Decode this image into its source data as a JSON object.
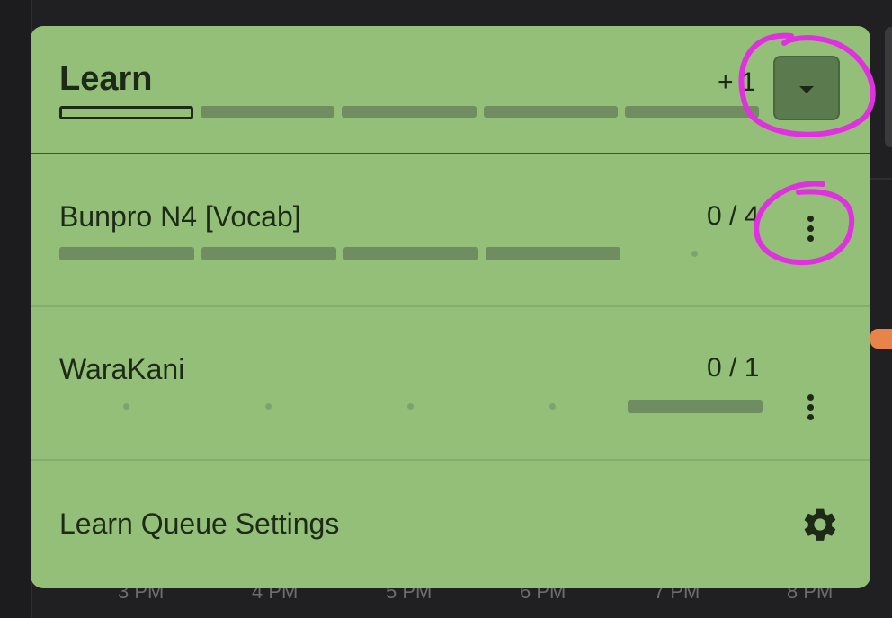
{
  "popover": {
    "title": "Learn",
    "count": "+ 1",
    "dropdown_icon": "caret-down-icon",
    "segments_total": 5,
    "segments_active_index": 0
  },
  "queues": [
    {
      "name": "Bunpro N4 [Vocab]",
      "count": "0 / 4",
      "menu_icon": "kebab-menu-icon"
    },
    {
      "name": "WaraKani",
      "count": "0 / 1",
      "menu_icon": "kebab-menu-icon"
    }
  ],
  "settings": {
    "label": "Learn Queue Settings",
    "icon": "gear-icon"
  },
  "chart_axis": {
    "labels": [
      "3 PM",
      "4 PM",
      "5 PM",
      "6 PM",
      "7 PM",
      "8 PM"
    ]
  },
  "colors": {
    "popover_bg": "#93bf78",
    "annotation": "#e030e0",
    "accent_orange": "#e8834a"
  }
}
